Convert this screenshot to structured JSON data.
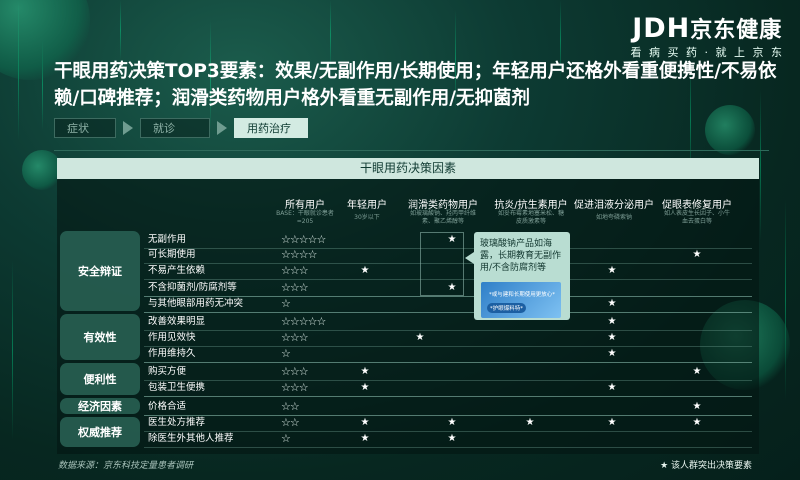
{
  "brand": {
    "logo_text": "JDH",
    "logo_cn": "京东健康",
    "slogan": "看 病 买 药 · 就 上 京 东"
  },
  "headline": "干眼用药决策TOP3要素：效果/无副作用/长期使用；年轻用户还格外看重便携性/不易依赖/口碑推荐；润滑类药物用户格外看重无副作用/无抑菌剂",
  "journey": {
    "steps": [
      {
        "label": "症状",
        "active": false
      },
      {
        "label": "就诊",
        "active": false
      },
      {
        "label": "用药治疗",
        "active": true
      }
    ]
  },
  "table": {
    "title": "干眼用药决策因素",
    "columns": [
      {
        "label": "所有用户",
        "sub": "BASE：干眼就诊患者=205"
      },
      {
        "label": "年轻用户",
        "sub": "30岁以下"
      },
      {
        "label": "润滑类药物用户",
        "sub": "如玻璃酸钠、羟丙甲纤维素、聚乙烯醇等"
      },
      {
        "label": "抗炎/抗生素用户",
        "sub": "如妥布霉素地塞米松、糖皮质激素等"
      },
      {
        "label": "促进泪液分泌用户",
        "sub": "如地夸磷索钠"
      },
      {
        "label": "促眼表修复用户",
        "sub": "如人表皮生长因子、小牛血去蛋白等"
      }
    ],
    "categories": [
      {
        "label": "安全辩证"
      },
      {
        "label": "有效性"
      },
      {
        "label": "便利性"
      },
      {
        "label": "经济因素"
      },
      {
        "label": "权威推荐"
      }
    ],
    "rows": [
      {
        "label": "无副作用",
        "stars": "☆☆☆☆☆",
        "marks": [
          false,
          false,
          true,
          false,
          false,
          false
        ]
      },
      {
        "label": "可长期使用",
        "stars": "☆☆☆☆",
        "marks": [
          false,
          false,
          false,
          false,
          false,
          true
        ]
      },
      {
        "label": "不易产生依赖",
        "stars": "☆☆☆",
        "marks": [
          true,
          false,
          false,
          false,
          true,
          false
        ]
      },
      {
        "label": "不含抑菌剂/防腐剂等",
        "stars": "☆☆☆",
        "marks": [
          false,
          false,
          true,
          false,
          false,
          false
        ]
      },
      {
        "label": "与其他眼部用药无冲突",
        "stars": "☆",
        "marks": [
          false,
          false,
          false,
          false,
          true,
          false
        ]
      },
      {
        "label": "改善效果明显",
        "stars": "☆☆☆☆☆",
        "marks": [
          false,
          false,
          false,
          false,
          true,
          false
        ]
      },
      {
        "label": "作用见效快",
        "stars": "☆☆☆",
        "marks": [
          false,
          true,
          false,
          false,
          true,
          false
        ]
      },
      {
        "label": "作用维持久",
        "stars": "☆",
        "marks": [
          false,
          false,
          false,
          false,
          true,
          false
        ]
      },
      {
        "label": "购买方便",
        "stars": "☆☆☆",
        "marks": [
          true,
          false,
          false,
          false,
          false,
          true
        ]
      },
      {
        "label": "包装卫生便携",
        "stars": "☆☆☆",
        "marks": [
          true,
          false,
          false,
          false,
          true,
          false
        ]
      },
      {
        "label": "价格合适",
        "stars": "☆☆",
        "marks": [
          false,
          false,
          false,
          false,
          false,
          true
        ]
      },
      {
        "label": "医生处方推荐",
        "stars": "☆☆",
        "marks": [
          true,
          false,
          true,
          true,
          true,
          true
        ]
      },
      {
        "label": "除医生外其他人推荐",
        "stars": "☆",
        "marks": [
          true,
          false,
          true,
          false,
          false,
          false
        ]
      }
    ],
    "star_symbol": "★"
  },
  "callout": {
    "text": "玻璃酸钠产品如海露，长期教育无副作用/不含防腐剂等",
    "product_line1": "*或与建和长期使用更放心*",
    "product_line2": "*护眼爆料特*"
  },
  "footer": {
    "source": "数据来源：京东科技定量患者调研",
    "legend": "★ 该人群突出决策要素"
  },
  "colors": {
    "background": "#0b3530",
    "accent": "#cfe7de",
    "category_bg": "#285f52"
  }
}
